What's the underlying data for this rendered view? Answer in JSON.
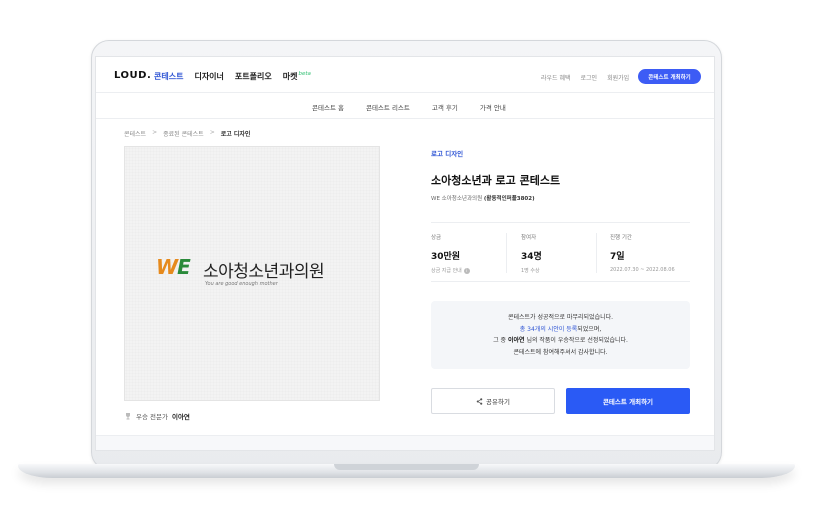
{
  "nav": {
    "logo": "LOUD.",
    "items": [
      {
        "label": "콘테스트",
        "active": true
      },
      {
        "label": "디자이너",
        "active": false
      },
      {
        "label": "포트폴리오",
        "active": false
      },
      {
        "label": "마켓",
        "active": false
      }
    ],
    "beta": "beta",
    "util": [
      "라우드 혜택",
      "로그인",
      "회원가입"
    ],
    "host_button": "콘테스트 개최하기"
  },
  "subnav": [
    "콘테스트 홈",
    "콘테스트 리스트",
    "고객 후기",
    "가격 안내"
  ],
  "breadcrumb": [
    "콘테스트",
    "종료된 콘테스트",
    "로고 디자인"
  ],
  "image": {
    "logo_w": "W",
    "logo_e": "E",
    "logo_text": "소아청소년과의원",
    "tagline": "You are good enough mother"
  },
  "winner": {
    "label": "우승 전문가",
    "name": "이아연"
  },
  "contest": {
    "category": "로고 디자인",
    "title": "소아청소년과 로고 콘테스트",
    "host_name": "WE 소아청소년과의원",
    "host_handle": "(활동적인퍼플3802)"
  },
  "stats": [
    {
      "label": "상금",
      "value": "30만원",
      "sub": "상금 지급 안내"
    },
    {
      "label": "참여자",
      "value": "34명",
      "sub": "1명 수상"
    },
    {
      "label": "진행 기간",
      "value": "7일",
      "sub": "2022.07.30 ~ 2022.08.06"
    }
  ],
  "notice": {
    "line1": "콘테스트가 성공적으로 마무리되었습니다.",
    "line2_link": "총 34개의 시안이 등록",
    "line2_rest": "되었으며,",
    "line3_pre": "그 중",
    "line3_name": "이아연",
    "line3_rest": "님의 작품이 우승작으로 선정되었습니다.",
    "line4": "콘테스트에 참여해주셔서 감사합니다."
  },
  "buttons": {
    "share": "공유하기",
    "host": "콘테스트 개최하기"
  },
  "colors": {
    "accent": "#2a5af5",
    "link": "#2f55d4",
    "logo_orange": "#e68a1d",
    "logo_green": "#2a8a3a"
  }
}
